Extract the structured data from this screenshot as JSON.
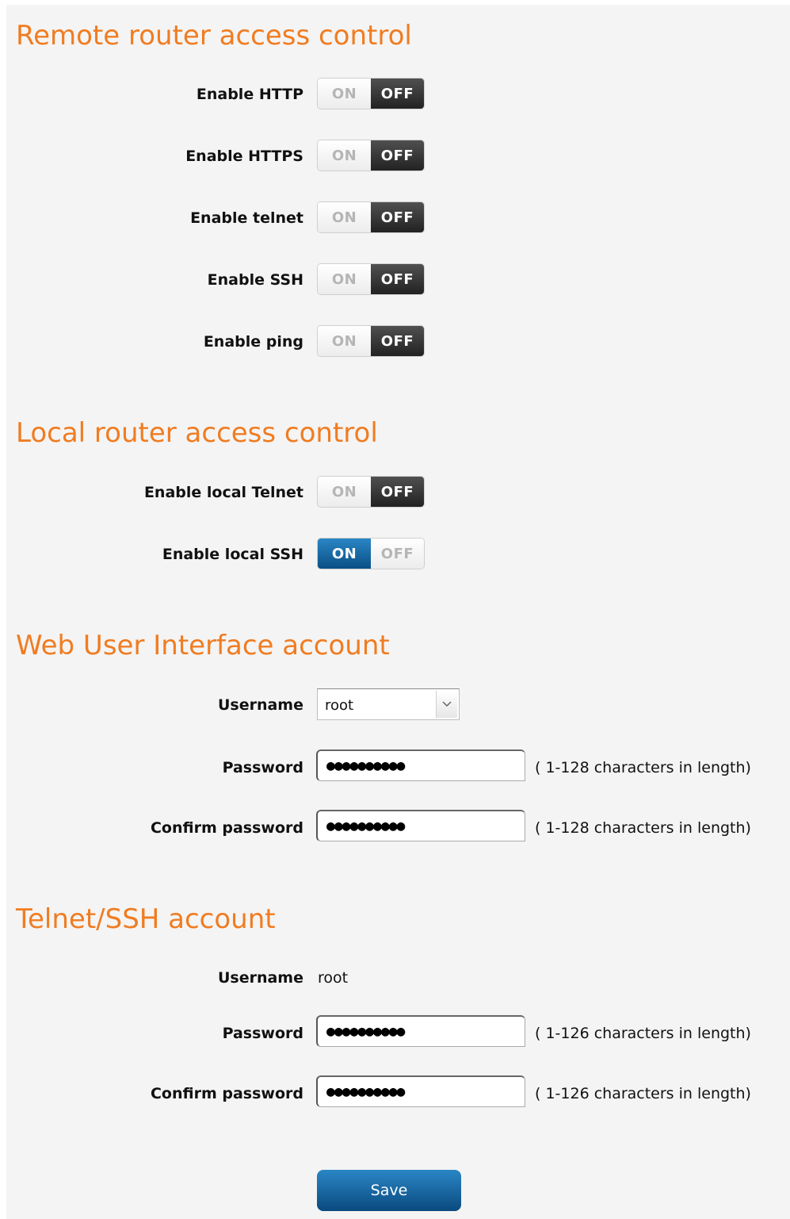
{
  "remote": {
    "title": "Remote router access control",
    "rows": [
      {
        "label": "Enable HTTP",
        "on_label": "ON",
        "off_label": "OFF",
        "state": "off"
      },
      {
        "label": "Enable HTTPS",
        "on_label": "ON",
        "off_label": "OFF",
        "state": "off"
      },
      {
        "label": "Enable telnet",
        "on_label": "ON",
        "off_label": "OFF",
        "state": "off"
      },
      {
        "label": "Enable SSH",
        "on_label": "ON",
        "off_label": "OFF",
        "state": "off"
      },
      {
        "label": "Enable ping",
        "on_label": "ON",
        "off_label": "OFF",
        "state": "off"
      }
    ]
  },
  "local": {
    "title": "Local router access control",
    "rows": [
      {
        "label": "Enable local Telnet",
        "on_label": "ON",
        "off_label": "OFF",
        "state": "off"
      },
      {
        "label": "Enable local SSH",
        "on_label": "ON",
        "off_label": "OFF",
        "state": "on"
      }
    ]
  },
  "web_account": {
    "title": "Web User Interface account",
    "username_label": "Username",
    "username_value": "root",
    "password_label": "Password",
    "password_dots": "●●●●●●●●●●",
    "password_hint": "( 1-128 characters in length)",
    "confirm_label": "Confirm password",
    "confirm_dots": "●●●●●●●●●●",
    "confirm_hint": "( 1-128 characters in length)"
  },
  "ssh_account": {
    "title": "Telnet/SSH account",
    "username_label": "Username",
    "username_value": "root",
    "password_label": "Password",
    "password_dots": "●●●●●●●●●●",
    "password_hint": "( 1-126 characters in length)",
    "confirm_label": "Confirm password",
    "confirm_dots": "●●●●●●●●●●",
    "confirm_hint": "( 1-126 characters in length)"
  },
  "save_label": "Save",
  "colors": {
    "heading": "#f07c21",
    "toggle_on": "#0a5a95",
    "toggle_off": "#333333",
    "panel_bg": "#f4f4f4"
  },
  "icons": {
    "select_arrow": "chevron-down-icon"
  }
}
